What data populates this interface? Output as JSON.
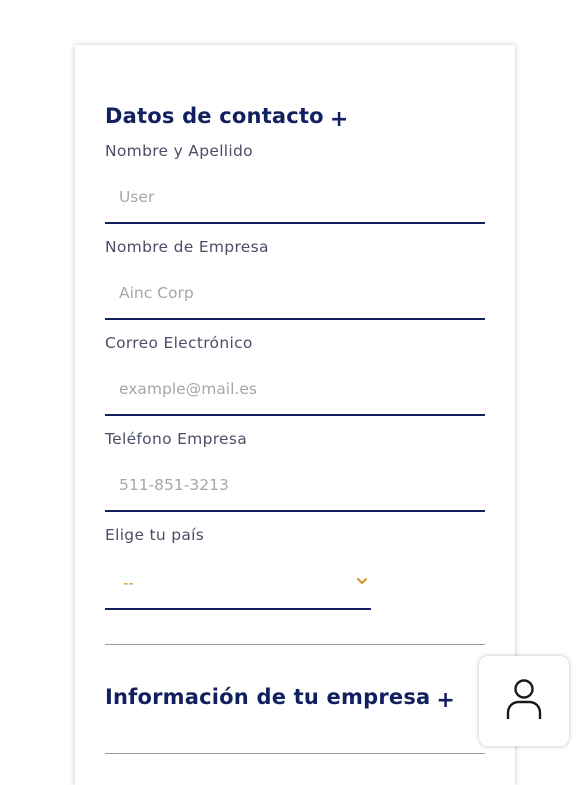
{
  "contact_section": {
    "title": "Datos de contacto",
    "expand_symbol": "+"
  },
  "fields": {
    "name": {
      "label": "Nombre y Apellido",
      "placeholder": "User",
      "value": ""
    },
    "company": {
      "label": "Nombre de Empresa",
      "placeholder": "Ainc Corp",
      "value": ""
    },
    "email": {
      "label": "Correo Electrónico",
      "placeholder": "example@mail.es",
      "value": ""
    },
    "phone": {
      "label": "Teléfono Empresa",
      "placeholder": "511-851-3213",
      "value": ""
    }
  },
  "country": {
    "label": "Elige tu país",
    "selected": "--"
  },
  "company_section": {
    "title": "Información de tu empresa",
    "expand_symbol": "+"
  },
  "icons": {
    "chevron": "chevron-down-icon",
    "user": "user-icon"
  },
  "colors": {
    "primary": "#11205f",
    "select_accent": "#d9902b",
    "placeholder": "#a7a7a7"
  }
}
